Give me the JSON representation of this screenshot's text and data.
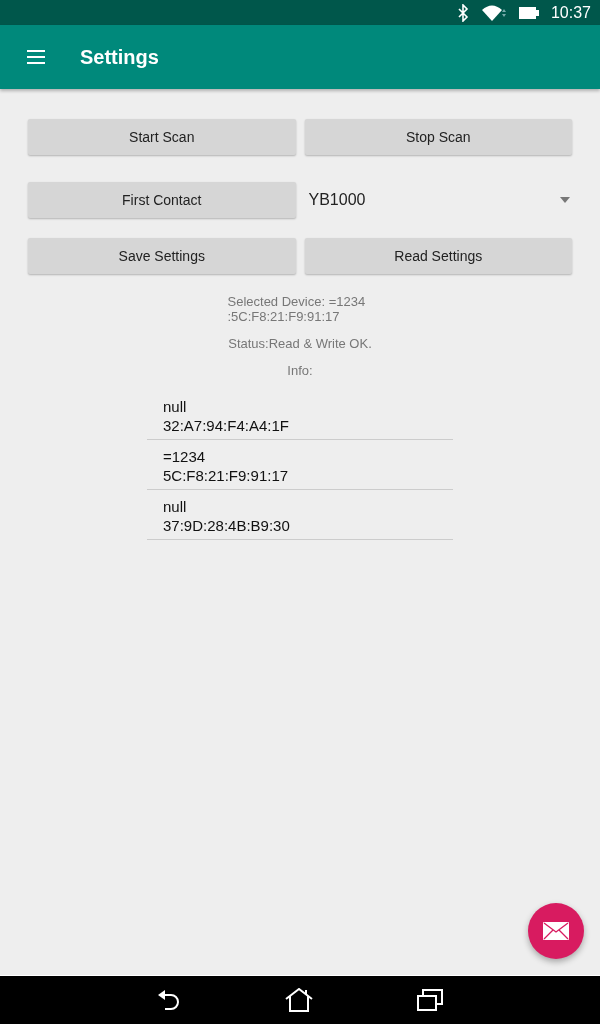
{
  "status_bar": {
    "time": "10:37"
  },
  "app_bar": {
    "title": "Settings"
  },
  "buttons_row_1": [
    "Start Scan",
    "Stop Scan"
  ],
  "first_contact_button": "First Contact",
  "device_dropdown": {
    "value": "YB1000"
  },
  "buttons_row_3": [
    "Save Settings",
    "Read Settings"
  ],
  "selected_device": "Selected Device: =1234\n:5C:F8:21:F9:91:17",
  "status": "Status:Read & Write OK.",
  "info_label": "Info:",
  "devices": [
    {
      "name": "null",
      "address": "32:A7:94:F4:A4:1F"
    },
    {
      "name": "=1234",
      "address": "5C:F8:21:F9:91:17"
    },
    {
      "name": "null",
      "address": "37:9D:28:4B:B9:30"
    }
  ]
}
